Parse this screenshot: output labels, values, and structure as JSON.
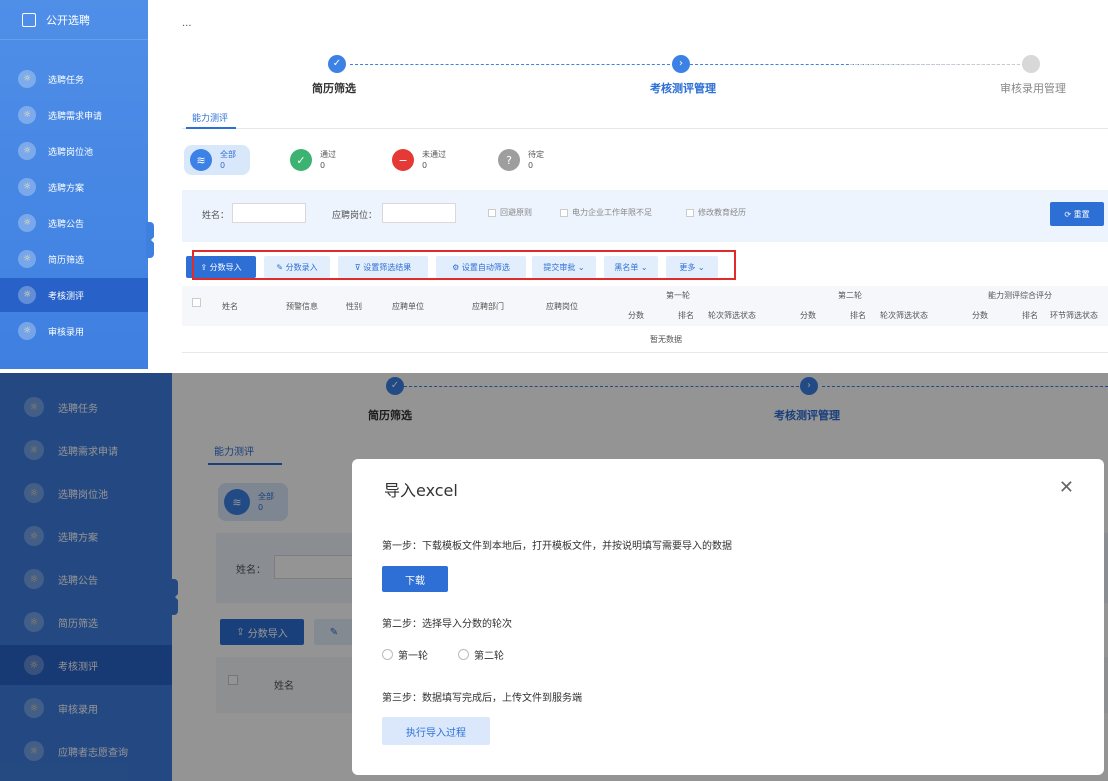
{
  "app": {
    "title": "公开选聘",
    "breadcrumb": "..."
  },
  "sidebar": {
    "items": [
      {
        "label": "选聘任务"
      },
      {
        "label": "选聘需求申请"
      },
      {
        "label": "选聘岗位池"
      },
      {
        "label": "选聘方案"
      },
      {
        "label": "选聘公告"
      },
      {
        "label": "简历筛选"
      },
      {
        "label": "考核测评"
      },
      {
        "label": "审核录用"
      },
      {
        "label": "应聘者志愿查询"
      }
    ]
  },
  "steps": [
    {
      "label": "简历筛选",
      "status": "done"
    },
    {
      "label": "考核测评管理",
      "status": "current"
    },
    {
      "label": "审核录用管理",
      "status": "pending"
    }
  ],
  "tabs": [
    {
      "label": "能力测评"
    }
  ],
  "stats": [
    {
      "label": "全部",
      "count": "0",
      "color": "#3c82e6"
    },
    {
      "label": "通过",
      "count": "0",
      "color": "#3cb371"
    },
    {
      "label": "未通过",
      "count": "0",
      "color": "#e53935"
    },
    {
      "label": "待定",
      "count": "0",
      "color": "#9e9e9e"
    }
  ],
  "filter": {
    "name_label": "姓名：",
    "position_label": "应聘岗位：",
    "checkboxes": [
      "回避原则",
      "电力企业工作年限不足",
      "修改教育经历"
    ],
    "reset_label": "重置"
  },
  "toolbar": {
    "buttons": [
      "分数导入",
      "分数录入",
      "设置筛选结果",
      "设置自动筛选",
      "提交审批",
      "黑名单",
      "更多"
    ]
  },
  "table": {
    "headers": [
      "姓名",
      "预警信息",
      "性别",
      "应聘单位",
      "应聘部门",
      "应聘岗位"
    ],
    "groups": [
      "第一轮",
      "第二轮",
      "能力测评综合评分"
    ],
    "sub_headers": [
      "分数",
      "排名",
      "轮次筛选状态",
      "分数",
      "排名",
      "轮次筛选状态",
      "分数",
      "排名",
      "环节筛选状态"
    ],
    "empty_text": "暂无数据"
  },
  "modal": {
    "title": "导入excel",
    "step1": "第一步：下载模板文件到本地后，打开模板文件，并按说明填写需要导入的数据",
    "download_label": "下载",
    "step2": "第二步：选择导入分数的轮次",
    "rounds": [
      "第一轮",
      "第二轮"
    ],
    "step3": "第三步：数据填写完成后，上传文件到服务端",
    "execute_label": "执行导入过程"
  }
}
